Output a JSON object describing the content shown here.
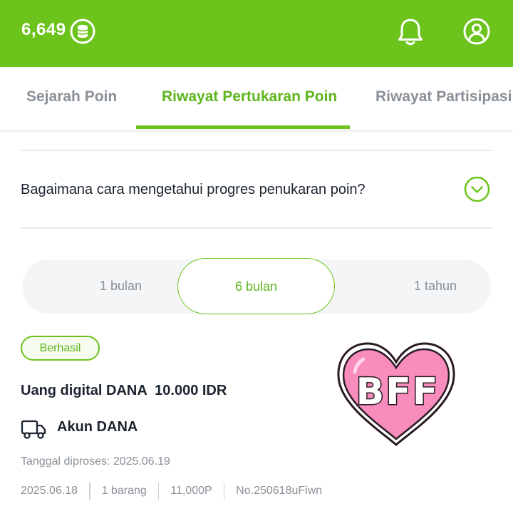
{
  "header": {
    "points": "6,649",
    "coin_icon": "coin-stack-icon",
    "bell_icon": "bell-icon",
    "profile_icon": "user-circle-icon",
    "bar_color": "#6cc31c"
  },
  "tabs": [
    {
      "label": "Sejarah Poin",
      "active": false
    },
    {
      "label": "Riwayat Pertukaran Poin",
      "active": true
    },
    {
      "label": "Riwayat Partisipasi S",
      "active": false
    }
  ],
  "faq": {
    "question": "Bagaimana cara mengetahui progres penukaran poin?",
    "expand_icon": "chevron-down-circle-icon"
  },
  "period_filter": {
    "options": [
      "1 bulan",
      "6 bulan",
      "1 tahun"
    ],
    "selected": "6 bulan"
  },
  "transaction": {
    "status": "Berhasil",
    "product": "Uang digital DANA  10.000 IDR",
    "delivery_icon": "truck-icon",
    "account": "Akun DANA",
    "processed_date": "Tanggal diproses: 2025.06.19",
    "order_date": "2025.06.18",
    "quantity": "1 barang",
    "points_cost": "11,000P",
    "order_number": "No.250618uFiwn"
  },
  "sticker": {
    "text": "BFF",
    "shape": "heart",
    "fill_color": "#f78cbd"
  },
  "colors": {
    "accent": "#6cc31c",
    "accent_text": "#5fb51d",
    "muted_text": "#8a9097",
    "divider": "#e3ebef"
  }
}
